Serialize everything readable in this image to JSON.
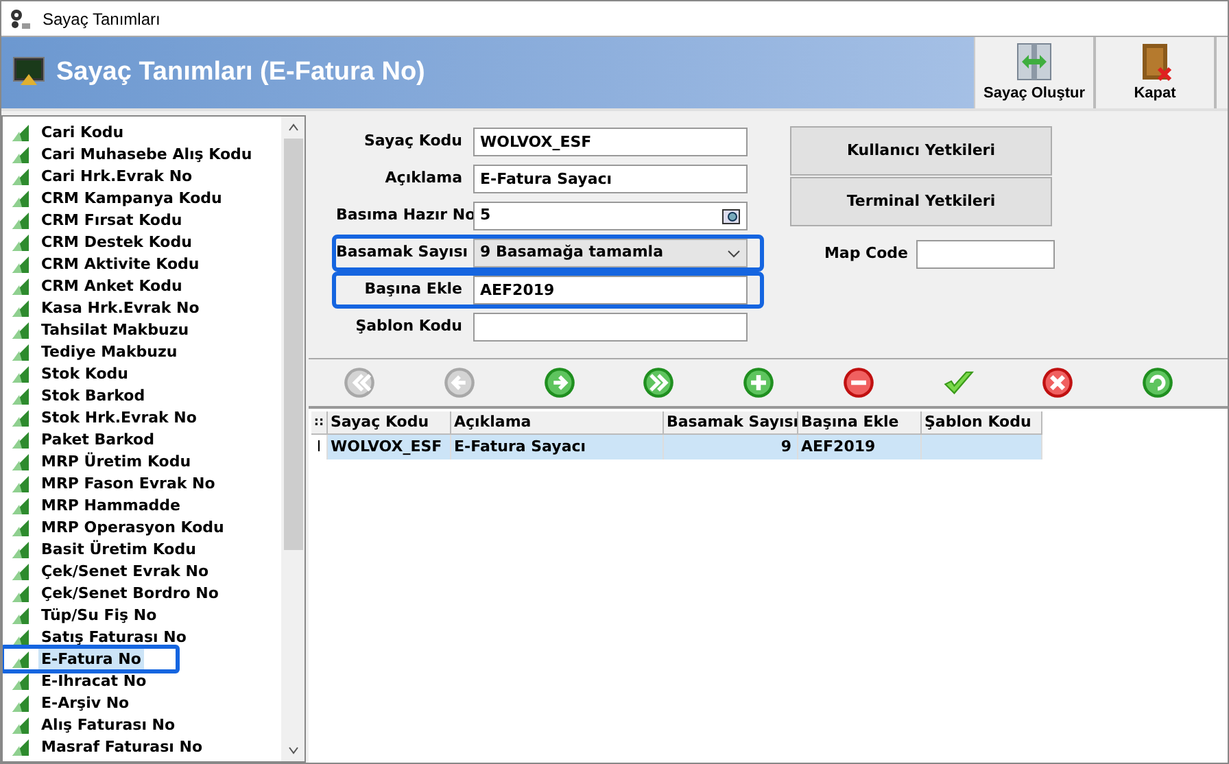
{
  "window": {
    "title": "Sayaç Tanımları"
  },
  "header": {
    "title": "Sayaç Tanımları (E-Fatura No)"
  },
  "toolbar": [
    {
      "label": "Sayaç Oluştur",
      "kind": "create"
    },
    {
      "label": "Kapat",
      "kind": "close"
    }
  ],
  "sidebar": {
    "items": [
      {
        "label": "Cari Kodu",
        "selected": false
      },
      {
        "label": "Cari Muhasebe Alış Kodu",
        "selected": false
      },
      {
        "label": "Cari Hrk.Evrak No",
        "selected": false
      },
      {
        "label": "CRM Kampanya Kodu",
        "selected": false
      },
      {
        "label": "CRM Fırsat Kodu",
        "selected": false
      },
      {
        "label": "CRM Destek Kodu",
        "selected": false
      },
      {
        "label": "CRM Aktivite Kodu",
        "selected": false
      },
      {
        "label": "CRM Anket Kodu",
        "selected": false
      },
      {
        "label": "Kasa Hrk.Evrak No",
        "selected": false
      },
      {
        "label": "Tahsilat Makbuzu",
        "selected": false
      },
      {
        "label": "Tediye Makbuzu",
        "selected": false
      },
      {
        "label": "Stok Kodu",
        "selected": false
      },
      {
        "label": "Stok Barkod",
        "selected": false
      },
      {
        "label": "Stok Hrk.Evrak No",
        "selected": false
      },
      {
        "label": "Paket Barkod",
        "selected": false
      },
      {
        "label": "MRP Üretim Kodu",
        "selected": false
      },
      {
        "label": "MRP Fason Evrak No",
        "selected": false
      },
      {
        "label": "MRP Hammadde",
        "selected": false
      },
      {
        "label": "MRP Operasyon Kodu",
        "selected": false
      },
      {
        "label": "Basit Üretim Kodu",
        "selected": false
      },
      {
        "label": "Çek/Senet Evrak No",
        "selected": false
      },
      {
        "label": "Çek/Senet Bordro No",
        "selected": false
      },
      {
        "label": "Tüp/Su Fiş No",
        "selected": false
      },
      {
        "label": "Satış Faturası No",
        "selected": false
      },
      {
        "label": "E-Fatura No",
        "selected": true
      },
      {
        "label": "E-Ihracat No",
        "selected": false
      },
      {
        "label": "E-Arşiv No",
        "selected": false
      },
      {
        "label": "Alış Faturası No",
        "selected": false
      },
      {
        "label": "Masraf Faturası No",
        "selected": false
      }
    ]
  },
  "form": {
    "fields": [
      {
        "label": "Sayaç Kodu",
        "value": "WOLVOX_ESF",
        "kind": "text",
        "highlighted": false
      },
      {
        "label": "Açıklama",
        "value": "E-Fatura Sayacı",
        "kind": "text",
        "highlighted": false
      },
      {
        "label": "Basıma Hazır No",
        "value": "5",
        "kind": "lookup",
        "highlighted": false
      },
      {
        "label": "Basamak Sayısı",
        "value": "9 Basamağa tamamla",
        "kind": "select",
        "highlighted": true
      },
      {
        "label": "Başına Ekle",
        "value": "AEF2019",
        "kind": "text",
        "highlighted": true
      },
      {
        "label": "Şablon Kodu",
        "kind": "text",
        "highlighted": false
      }
    ],
    "buttons": [
      "Kullanıcı Yetkileri",
      "Terminal Yetkileri"
    ],
    "map_code": {
      "label": "Map Code"
    }
  },
  "navigator": [
    {
      "kind": "first",
      "disabled": true
    },
    {
      "kind": "prior",
      "disabled": true
    },
    {
      "kind": "next",
      "disabled": false
    },
    {
      "kind": "last",
      "disabled": false
    },
    {
      "kind": "add",
      "disabled": false
    },
    {
      "kind": "delete",
      "disabled": false
    },
    {
      "kind": "post",
      "disabled": false
    },
    {
      "kind": "cancel",
      "disabled": false
    },
    {
      "kind": "refresh",
      "disabled": false
    }
  ],
  "table": {
    "indicator_header": "::",
    "columns": [
      "Sayaç Kodu",
      "Açıklama",
      "Basamak Sayısı",
      "Başına Ekle",
      "Şablon Kodu"
    ],
    "rows": [
      {
        "indicator": "I",
        "cells": [
          "WOLVOX_ESF",
          "E-Fatura Sayacı",
          "9",
          "AEF2019",
          ""
        ],
        "selected": true
      }
    ]
  }
}
